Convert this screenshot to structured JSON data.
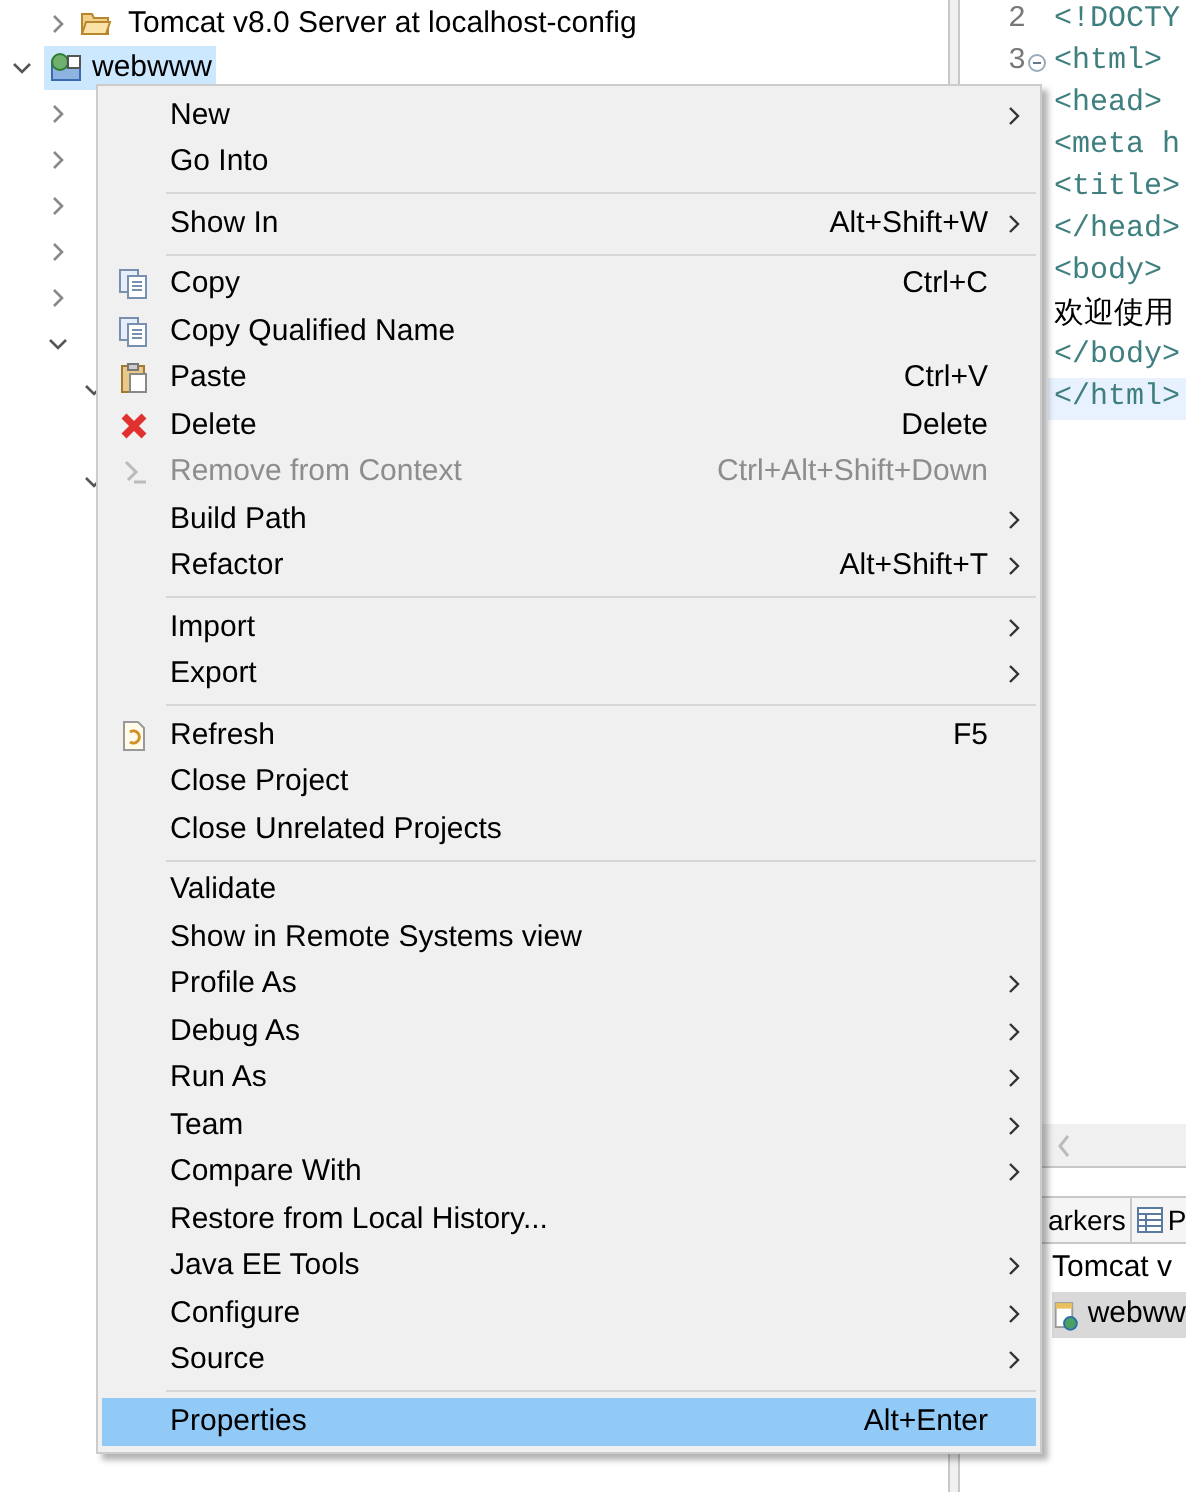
{
  "tree": {
    "rows": [
      {
        "label": "Tomcat v8.0 Server at localhost-config",
        "expanded": false,
        "selected": false
      },
      {
        "label": "webwww",
        "expanded": true,
        "selected": true
      }
    ]
  },
  "editor": {
    "line_numbers": [
      {
        "number": "2",
        "foldable": false
      },
      {
        "number": "3",
        "foldable": true
      }
    ],
    "lines": [
      {
        "text": "<!DOCTY",
        "current": false
      },
      {
        "text": "<html>",
        "current": false
      },
      {
        "text": "<head>",
        "current": false
      },
      {
        "text": "<meta h",
        "current": false
      },
      {
        "text": "<title>",
        "current": false
      },
      {
        "text": "</head>",
        "current": false
      },
      {
        "text": "<body>",
        "current": false
      },
      {
        "text": "欢迎使用",
        "current": false,
        "kind": "content"
      },
      {
        "text": "</body>",
        "current": false
      },
      {
        "text": "</html>",
        "current": true
      }
    ]
  },
  "bottom_panel": {
    "tabs": [
      {
        "label": "arkers",
        "selected": false
      },
      {
        "label": "P",
        "selected": false
      }
    ],
    "rows": [
      {
        "label": "Tomcat v",
        "selected": false
      },
      {
        "label": "webww",
        "selected": true
      }
    ]
  },
  "context_menu": {
    "groups": [
      [
        {
          "label": "New",
          "submenu": true,
          "disabled": false,
          "selected": false
        },
        {
          "label": "Go Into",
          "submenu": false,
          "disabled": false,
          "selected": false
        }
      ],
      [
        {
          "label": "Show In",
          "shortcut": "Alt+Shift+W",
          "submenu": true,
          "disabled": false,
          "selected": false
        }
      ],
      [
        {
          "label": "Copy",
          "shortcut": "Ctrl+C",
          "submenu": false,
          "disabled": false,
          "selected": false
        },
        {
          "label": "Copy Qualified Name",
          "submenu": false,
          "disabled": false,
          "selected": false
        },
        {
          "label": "Paste",
          "shortcut": "Ctrl+V",
          "submenu": false,
          "disabled": false,
          "selected": false
        },
        {
          "label": "Delete",
          "shortcut": "Delete",
          "submenu": false,
          "disabled": false,
          "selected": false
        },
        {
          "label": "Remove from Context",
          "shortcut": "Ctrl+Alt+Shift+Down",
          "submenu": false,
          "disabled": true,
          "selected": false
        },
        {
          "label": "Build Path",
          "submenu": true,
          "disabled": false,
          "selected": false
        },
        {
          "label": "Refactor",
          "shortcut": "Alt+Shift+T",
          "submenu": true,
          "disabled": false,
          "selected": false
        }
      ],
      [
        {
          "label": "Import",
          "submenu": true,
          "disabled": false,
          "selected": false
        },
        {
          "label": "Export",
          "submenu": true,
          "disabled": false,
          "selected": false
        }
      ],
      [
        {
          "label": "Refresh",
          "shortcut": "F5",
          "submenu": false,
          "disabled": false,
          "selected": false
        },
        {
          "label": "Close Project",
          "submenu": false,
          "disabled": false,
          "selected": false
        },
        {
          "label": "Close Unrelated Projects",
          "submenu": false,
          "disabled": false,
          "selected": false
        }
      ],
      [
        {
          "label": "Validate",
          "submenu": false,
          "disabled": false,
          "selected": false
        },
        {
          "label": "Show in Remote Systems view",
          "submenu": false,
          "disabled": false,
          "selected": false
        },
        {
          "label": "Profile As",
          "submenu": true,
          "disabled": false,
          "selected": false
        },
        {
          "label": "Debug As",
          "submenu": true,
          "disabled": false,
          "selected": false
        },
        {
          "label": "Run As",
          "submenu": true,
          "disabled": false,
          "selected": false
        },
        {
          "label": "Team",
          "submenu": true,
          "disabled": false,
          "selected": false
        },
        {
          "label": "Compare With",
          "submenu": true,
          "disabled": false,
          "selected": false
        },
        {
          "label": "Restore from Local History...",
          "submenu": false,
          "disabled": false,
          "selected": false
        },
        {
          "label": "Java EE Tools",
          "submenu": true,
          "disabled": false,
          "selected": false
        },
        {
          "label": "Configure",
          "submenu": true,
          "disabled": false,
          "selected": false
        },
        {
          "label": "Source",
          "submenu": true,
          "disabled": false,
          "selected": false
        }
      ],
      [
        {
          "label": "Properties",
          "shortcut": "Alt+Enter",
          "submenu": false,
          "disabled": false,
          "selected": true
        }
      ]
    ]
  }
}
